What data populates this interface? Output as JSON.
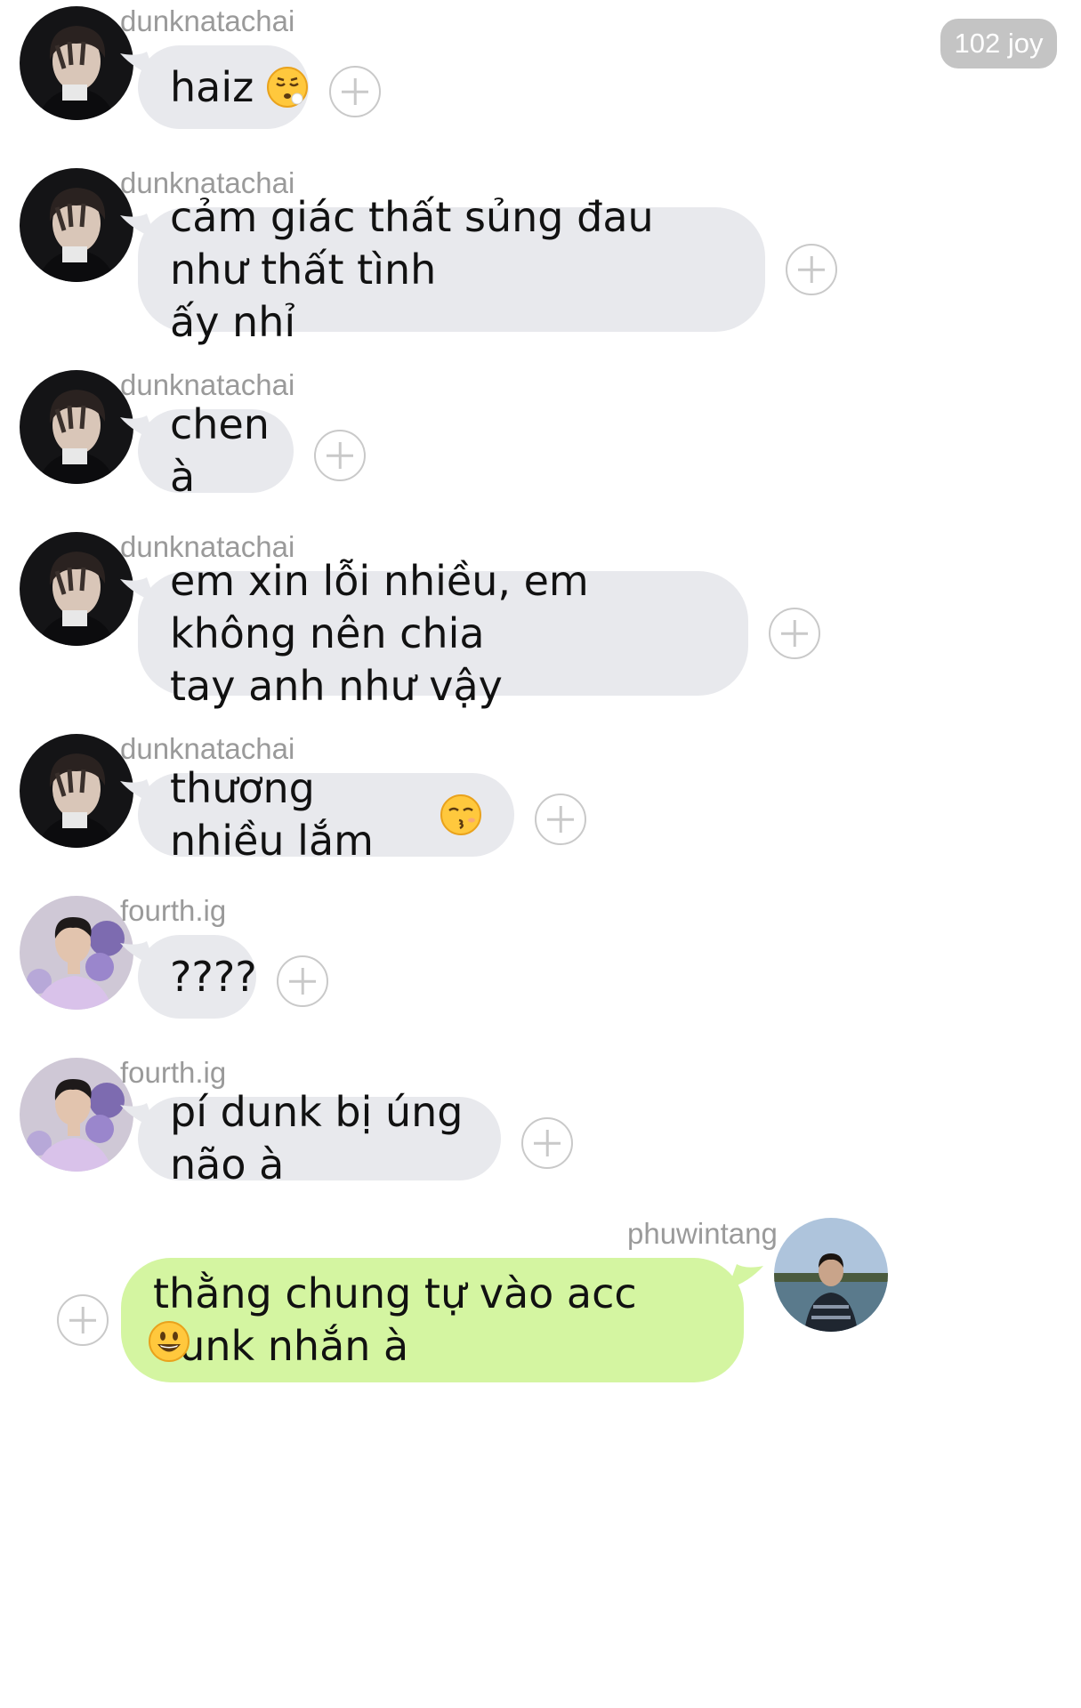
{
  "counter": {
    "label": "102 joy"
  },
  "messages": [
    {
      "user": "dunknatachai",
      "text": "haiz",
      "emoji": "sleepy-face-icon",
      "avatar": "dunk-avatar"
    },
    {
      "user": "dunknatachai",
      "text": "cảm giác thất sủng đau như thất tình\nấy nhỉ",
      "avatar": "dunk-avatar"
    },
    {
      "user": "dunknatachai",
      "text": "chen à",
      "avatar": "dunk-avatar"
    },
    {
      "user": "dunknatachai",
      "text": "em xin lỗi nhiều, em không nên chia\ntay anh như vậy",
      "avatar": "dunk-avatar"
    },
    {
      "user": "dunknatachai",
      "text": "thương nhiều lắm",
      "emoji": "kissing-face-icon",
      "avatar": "dunk-avatar"
    },
    {
      "user": "fourth.ig",
      "text": "????",
      "avatar": "fourth-avatar"
    },
    {
      "user": "fourth.ig",
      "text": "pí dunk bị úng não à",
      "avatar": "fourth-avatar"
    },
    {
      "user": "phuwintang",
      "text": "thằng chung tự vào acc dunk nhắn à",
      "emoji": "smiling-face-icon",
      "avatar": "phuwin-avatar"
    }
  ],
  "colors": {
    "incoming_bubble": "#e8e9ed",
    "outgoing_bubble": "#d4f5a1",
    "username": "#9a9a9a",
    "badge": "#c4c4c4"
  }
}
